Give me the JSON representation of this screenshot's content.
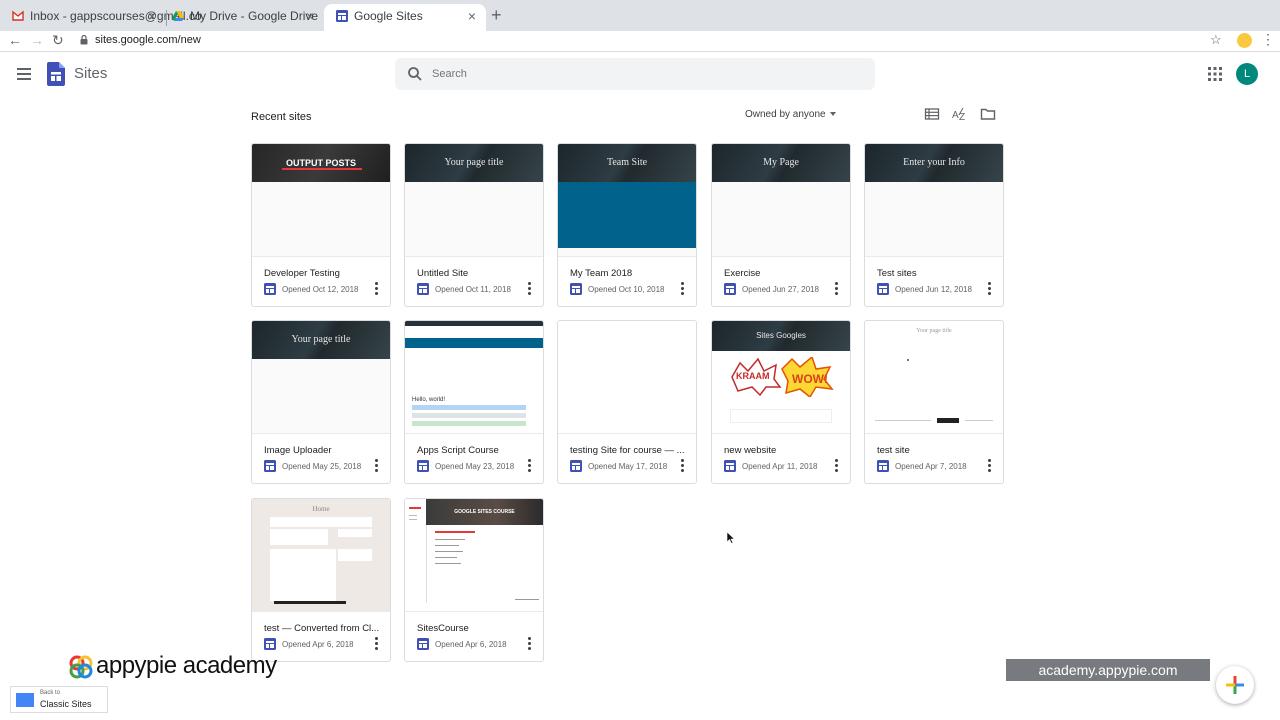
{
  "browser": {
    "tabs": [
      {
        "label": "Inbox - gappscourses@gmail.co",
        "icon": "gmail-icon"
      },
      {
        "label": "My Drive - Google Drive",
        "icon": "drive-icon"
      },
      {
        "label": "Google Sites",
        "icon": "sites-icon"
      }
    ],
    "url": "sites.google.com/new"
  },
  "app": {
    "title": "Sites",
    "search_placeholder": "Search",
    "avatar_letter": "L"
  },
  "section": {
    "title": "Recent sites",
    "owner_filter": "Owned by anyone"
  },
  "sites": [
    {
      "banner": "OUTPUT POSTS",
      "title": "Developer Testing",
      "opened": "Opened Oct 12, 2018"
    },
    {
      "banner": "Your page title",
      "title": "Untitled Site",
      "opened": "Opened Oct 11, 2018"
    },
    {
      "banner": "Team Site",
      "title": "My Team 2018",
      "opened": "Opened Oct 10, 2018"
    },
    {
      "banner": "My Page",
      "title": "Exercise",
      "opened": "Opened Jun 27, 2018"
    },
    {
      "banner": "Enter your Info",
      "title": "Test sites",
      "opened": "Opened Jun 12, 2018"
    },
    {
      "banner": "Your page title",
      "title": "Image Uploader",
      "opened": "Opened May 25, 2018"
    },
    {
      "banner": "Hello, world!",
      "title": "Apps Script Course",
      "opened": "Opened May 23, 2018"
    },
    {
      "banner": "",
      "title": "testing Site for course — ...",
      "opened": "Opened May 17, 2018"
    },
    {
      "banner": "Sites Googles",
      "title": "new website",
      "opened": "Opened Apr 11, 2018"
    },
    {
      "banner": "Your page title",
      "title": "test site",
      "opened": "Opened Apr 7, 2018"
    },
    {
      "banner": "Home",
      "title": "test — Converted from Cl...",
      "opened": "Opened Apr 6, 2018"
    },
    {
      "banner": "GOOGLE SITES COURSE",
      "title": "SitesCourse",
      "opened": "Opened Apr 6, 2018"
    }
  ],
  "overlay": {
    "brand": "appypie academy",
    "classic_line1": "Back to",
    "classic_line2": "Classic Sites",
    "watermark": "academy.appypie.com"
  },
  "colors": {
    "sites_blue": "#4285f4",
    "avatar_teal": "#00897b",
    "team_site_fill": "#01628c"
  }
}
